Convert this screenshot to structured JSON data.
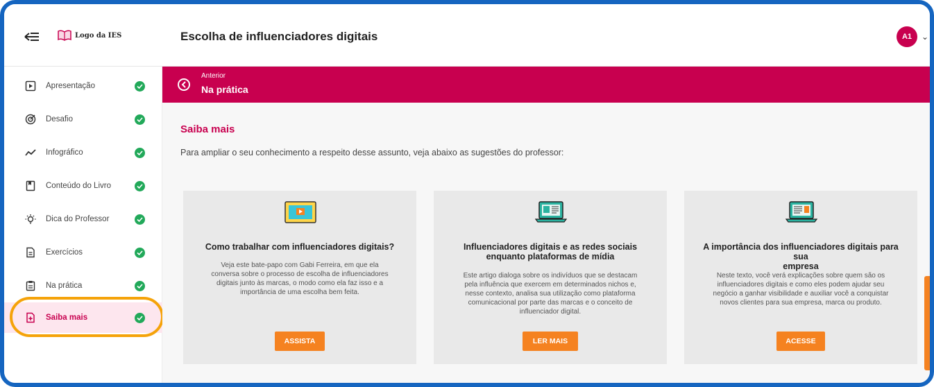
{
  "header": {
    "logo_text": "Logo da IES",
    "title": "Escolha de influenciadores digitais",
    "avatar_initials": "A1"
  },
  "sidebar": {
    "items": [
      {
        "label": "Apresentação",
        "icon": "play-box-icon",
        "done": true
      },
      {
        "label": "Desafio",
        "icon": "target-icon",
        "done": true
      },
      {
        "label": "Infográfico",
        "icon": "trend-line-icon",
        "done": true
      },
      {
        "label": "Conteúdo do Livro",
        "icon": "book-icon",
        "done": true
      },
      {
        "label": "Dica do Professor",
        "icon": "lightbulb-icon",
        "done": true
      },
      {
        "label": "Exercícios",
        "icon": "document-icon",
        "done": true
      },
      {
        "label": "Na prática",
        "icon": "clipboard-icon",
        "done": true
      },
      {
        "label": "Saiba mais",
        "icon": "add-document-icon",
        "done": true,
        "active": true
      }
    ]
  },
  "banner": {
    "previous_label": "Anterior",
    "current_label": "Na prática"
  },
  "main": {
    "section_title": "Saiba mais",
    "section_desc": "Para ampliar o seu conhecimento a respeito desse assunto, veja abaixo as sugestões do professor:",
    "cards": [
      {
        "icon": "video-screen-icon",
        "title_lines": [
          "Como trabalhar com influenciadores digitais?"
        ],
        "text_lines": [
          "Veja este bate-papo com Gabi Ferreira, em que ela",
          "conversa sobre o processo de escolha de influenciadores",
          "digitais junto às marcas, o modo como ela faz isso e a",
          "importância de uma escolha bem feita."
        ],
        "button": "ASSISTA"
      },
      {
        "icon": "laptop-article-icon",
        "title_lines": [
          "Influenciadores digitais e as redes sociais",
          "enquanto plataformas de mídia"
        ],
        "text_lines": [
          "Este artigo dialoga sobre os indivíduos que se destacam",
          "pela influência que exercem em determinados nichos e,",
          "nesse contexto, analisa sua utilização como plataforma",
          "comunicacional por parte das marcas e o conceito de",
          "influenciador digital."
        ],
        "button": "LER MAIS"
      },
      {
        "icon": "laptop-web-icon",
        "title_lines": [
          "A importância dos influenciadores digitais para sua",
          "empresa"
        ],
        "text_lines": [
          "Neste texto, você verá explicações sobre quem são os",
          "influenciadores digitais e como eles podem ajudar seu",
          "negócio a ganhar visibilidade e auxiliar você a conquistar",
          "novos clientes para sua empresa, marca ou produto."
        ],
        "button": "ACESSE"
      }
    ]
  },
  "colors": {
    "brand": "#c8004f",
    "accent": "#f58220",
    "success": "#22a95a",
    "highlight": "#f5a30a",
    "frame": "#1565c0"
  }
}
